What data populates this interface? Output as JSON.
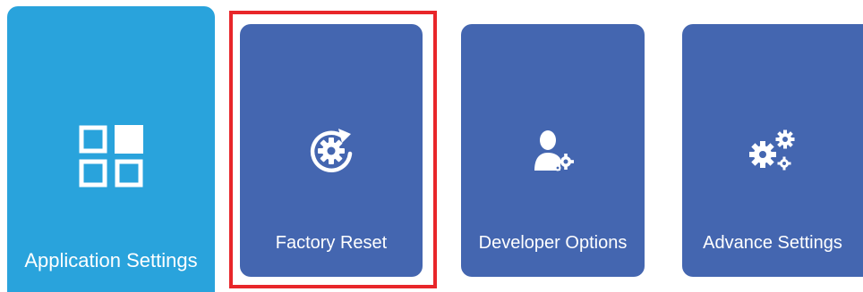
{
  "colors": {
    "tile_selected": "#29A3DC",
    "tile_default": "#4466B0",
    "highlight": "#E8262A",
    "text": "#FFFFFF"
  },
  "tiles": [
    {
      "id": "application-settings",
      "label": "Application Settings",
      "icon": "grid-icon",
      "selected": true
    },
    {
      "id": "factory-reset",
      "label": "Factory Reset",
      "icon": "factory-reset-icon",
      "selected": false,
      "highlighted": true
    },
    {
      "id": "developer-options",
      "label": "Developer Options",
      "icon": "developer-user-gear-icon",
      "selected": false
    },
    {
      "id": "advance-settings",
      "label": "Advance Settings",
      "icon": "gears-icon",
      "selected": false
    }
  ]
}
